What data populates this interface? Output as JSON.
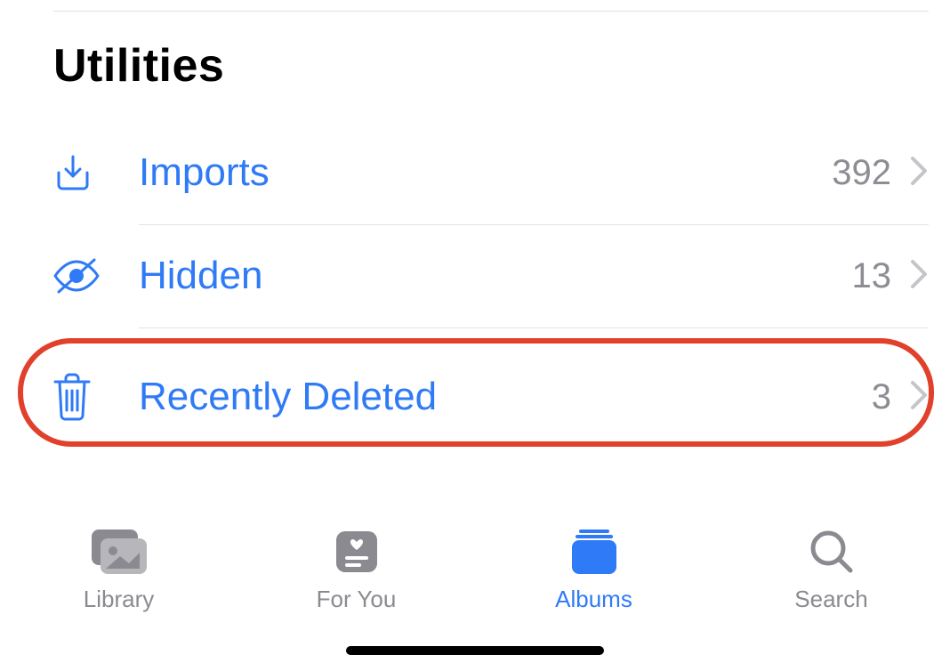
{
  "section_title": "Utilities",
  "rows": {
    "imports": {
      "label": "Imports",
      "count": "392"
    },
    "hidden": {
      "label": "Hidden",
      "count": "13"
    },
    "deleted": {
      "label": "Recently Deleted",
      "count": "3"
    }
  },
  "tabs": {
    "library": "Library",
    "foryou": "For You",
    "albums": "Albums",
    "search": "Search"
  },
  "active_tab": "albums",
  "highlighted_row": "deleted"
}
